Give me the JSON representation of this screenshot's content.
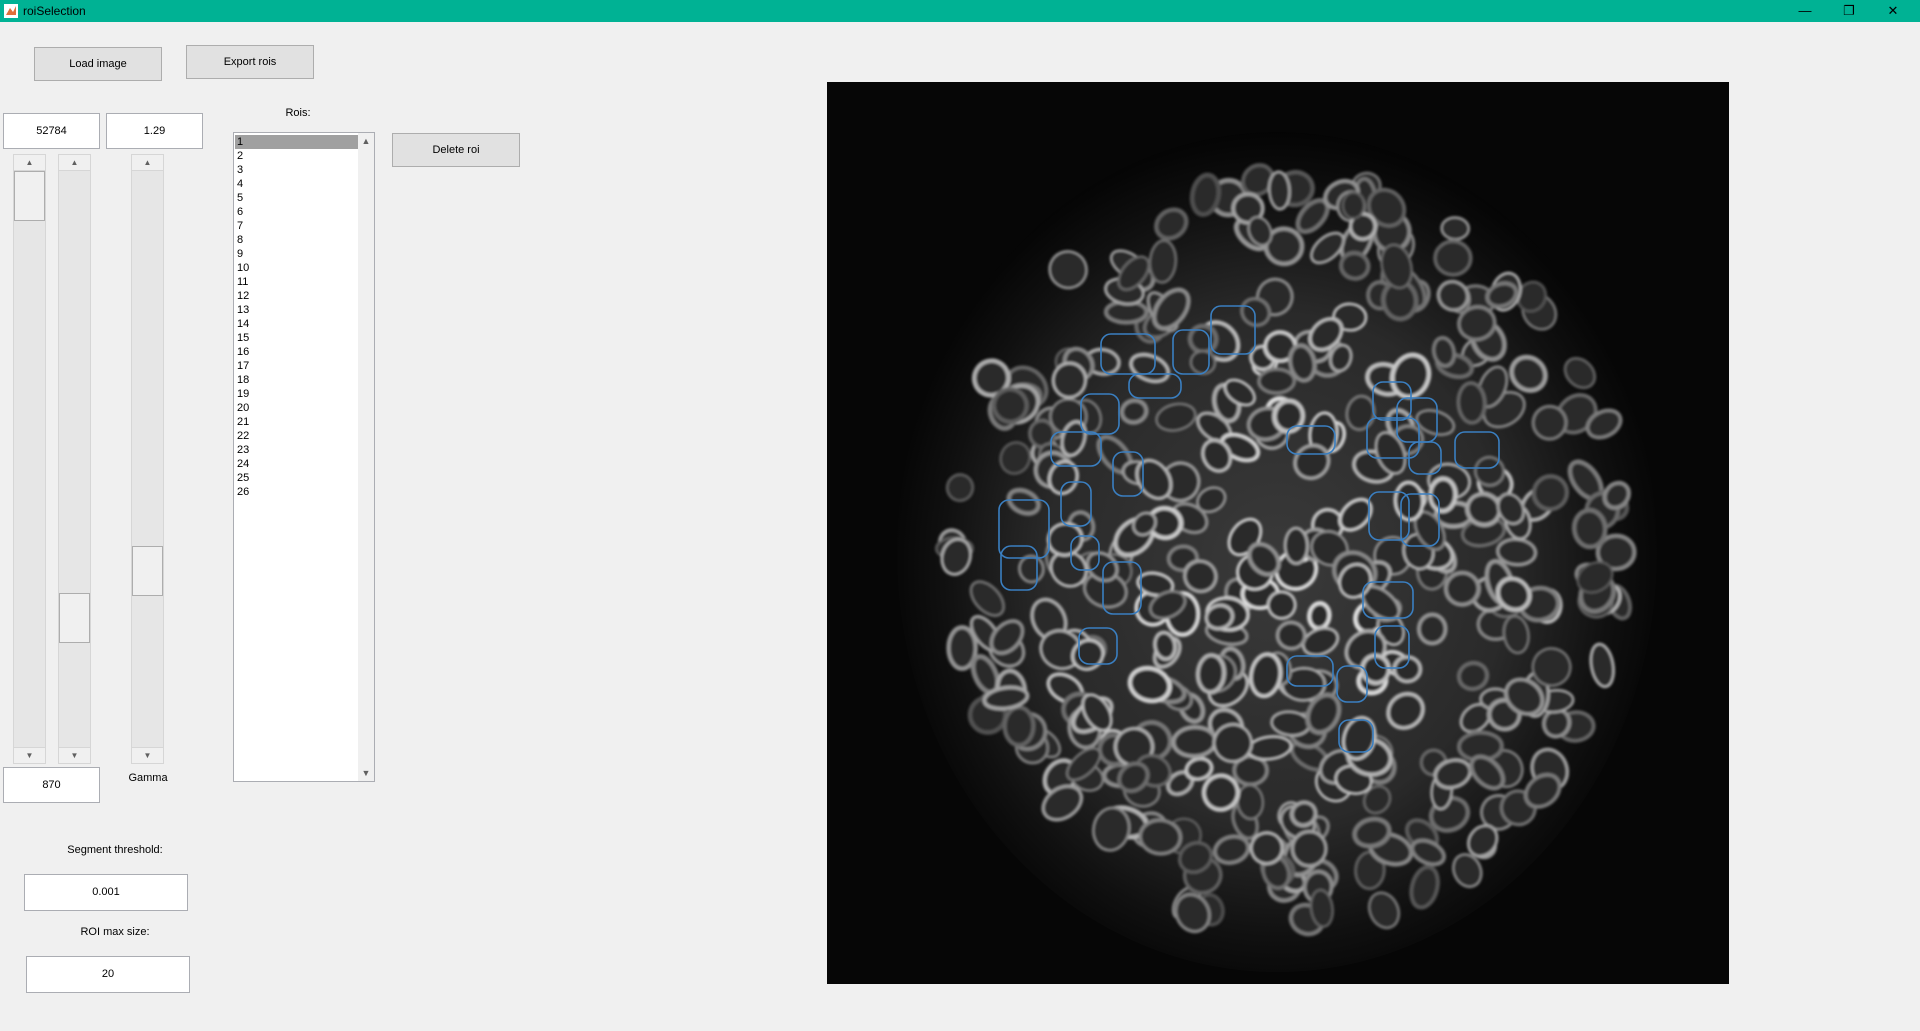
{
  "window": {
    "title": "roiSelection"
  },
  "buttons": {
    "load_image": "Load image",
    "export_rois": "Export rois",
    "delete_roi": "Delete roi"
  },
  "controls": {
    "max_value": "52784",
    "gamma_value": "1.29",
    "min_value": "870",
    "gamma_label": "Gamma",
    "segment_threshold_label": "Segment threshold:",
    "segment_threshold_value": "0.001",
    "roi_max_size_label": "ROI max size:",
    "roi_max_size_value": "20"
  },
  "sliders": {
    "max_slider_level": 1.0,
    "min_slider_level": 0.2,
    "gamma_slider_level": 0.29
  },
  "rois": {
    "label": "Rois:",
    "selected": "1",
    "items": [
      "1",
      "2",
      "3",
      "4",
      "5",
      "6",
      "7",
      "8",
      "9",
      "10",
      "11",
      "12",
      "13",
      "14",
      "15",
      "16",
      "17",
      "18",
      "19",
      "20",
      "21",
      "22",
      "23",
      "24",
      "25",
      "26"
    ]
  },
  "colors": {
    "titlebar": "#00b294",
    "roi_outline": "#3a7fc1",
    "background": "#f0f0f0"
  },
  "icons": {
    "app": "matlab-icon",
    "minimize": "minimize-icon",
    "restore": "restore-icon",
    "close": "close-icon"
  }
}
